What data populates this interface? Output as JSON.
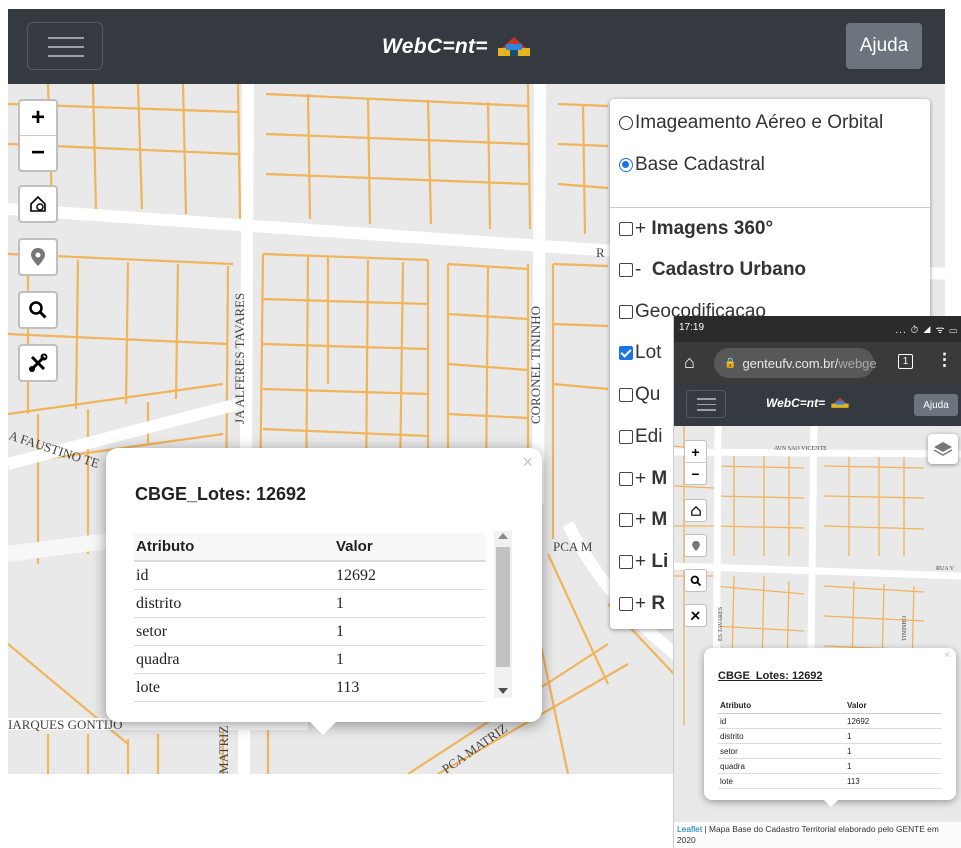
{
  "desktop": {
    "navbar": {
      "brand": "WebC=nt=",
      "help_label": "Ajuda"
    },
    "map_controls": {
      "zoom_in": "+",
      "zoom_out": "−",
      "search": "🔍"
    },
    "street_labels": {
      "alferes_tavares": "JA ALFERES TAVARES",
      "coronel_tininho": "CORONEL TININHO",
      "faustino": "A FAUSTINO TE",
      "marques_gontijo": "IARQUES GONTIJO",
      "pca_m": "PCA M",
      "pca_matriz": "PCA MATRIZ",
      "matriz": "MATRIZ",
      "r": "R"
    },
    "layers": {
      "base_layers": [
        {
          "label": "Imageamento Aéreo e Orbital",
          "selected": false
        },
        {
          "label": "Base Cadastral",
          "selected": true
        }
      ],
      "overlays": [
        {
          "prefix": "+",
          "label": "Imagens 360°",
          "bold": true,
          "checked": false
        },
        {
          "prefix": "-",
          "label": "Cadastro Urbano",
          "bold": true,
          "checked": false
        },
        {
          "prefix": "",
          "label": "Geocodificacao",
          "bold": false,
          "checked": false
        },
        {
          "prefix": "",
          "label": "Lot",
          "bold": false,
          "checked": true
        },
        {
          "prefix": "",
          "label": "Qu",
          "bold": false,
          "checked": false
        },
        {
          "prefix": "",
          "label": "Edi",
          "bold": false,
          "checked": false
        },
        {
          "prefix": "+",
          "label": "M",
          "bold": true,
          "checked": false
        },
        {
          "prefix": "+",
          "label": "M",
          "bold": true,
          "checked": false
        },
        {
          "prefix": "+",
          "label": "Li",
          "bold": true,
          "checked": false
        },
        {
          "prefix": "+",
          "label": "R",
          "bold": true,
          "checked": false
        }
      ]
    },
    "popup": {
      "close": "×",
      "title": "CBGE_Lotes: 12692",
      "columns": [
        "Atributo",
        "Valor"
      ],
      "rows": [
        [
          "id",
          "12692"
        ],
        [
          "distrito",
          "1"
        ],
        [
          "setor",
          "1"
        ],
        [
          "quadra",
          "1"
        ],
        [
          "lote",
          "113"
        ]
      ]
    }
  },
  "phone": {
    "status": {
      "time": "17:19",
      "icons": "... ⏱ ◢ ᯤ ▭"
    },
    "browser": {
      "url_host": "genteufv.com.br/",
      "url_rest": "webge",
      "tab_count": "1"
    },
    "navbar": {
      "brand": "WebC=nt=",
      "help_label": "Ajuda"
    },
    "street_labels": {
      "sao_vicente": "AVN SAO VICENTE",
      "rua_v": "RUA V",
      "tavares": "ES TAVARES",
      "tininho": "TININHO"
    },
    "controls": {
      "zoom_in": "+",
      "zoom_out": "−",
      "search": "🔍"
    },
    "popup": {
      "close": "×",
      "title": "CBGE_Lotes: 12692",
      "columns": [
        "Atributo",
        "Valor"
      ],
      "rows": [
        [
          "id",
          "12692"
        ],
        [
          "distrito",
          "1"
        ],
        [
          "setor",
          "1"
        ],
        [
          "quadra",
          "1"
        ],
        [
          "lote",
          "113"
        ]
      ]
    },
    "attribution": {
      "leaflet": "Leaflet",
      "text": " | Mapa Base do Cadastro Territorial elaborado pelo GENTE em 2020"
    }
  },
  "colors": {
    "navbar": "#343a40",
    "lot_lines": "#f0b45a",
    "accent": "#1a73e8"
  }
}
